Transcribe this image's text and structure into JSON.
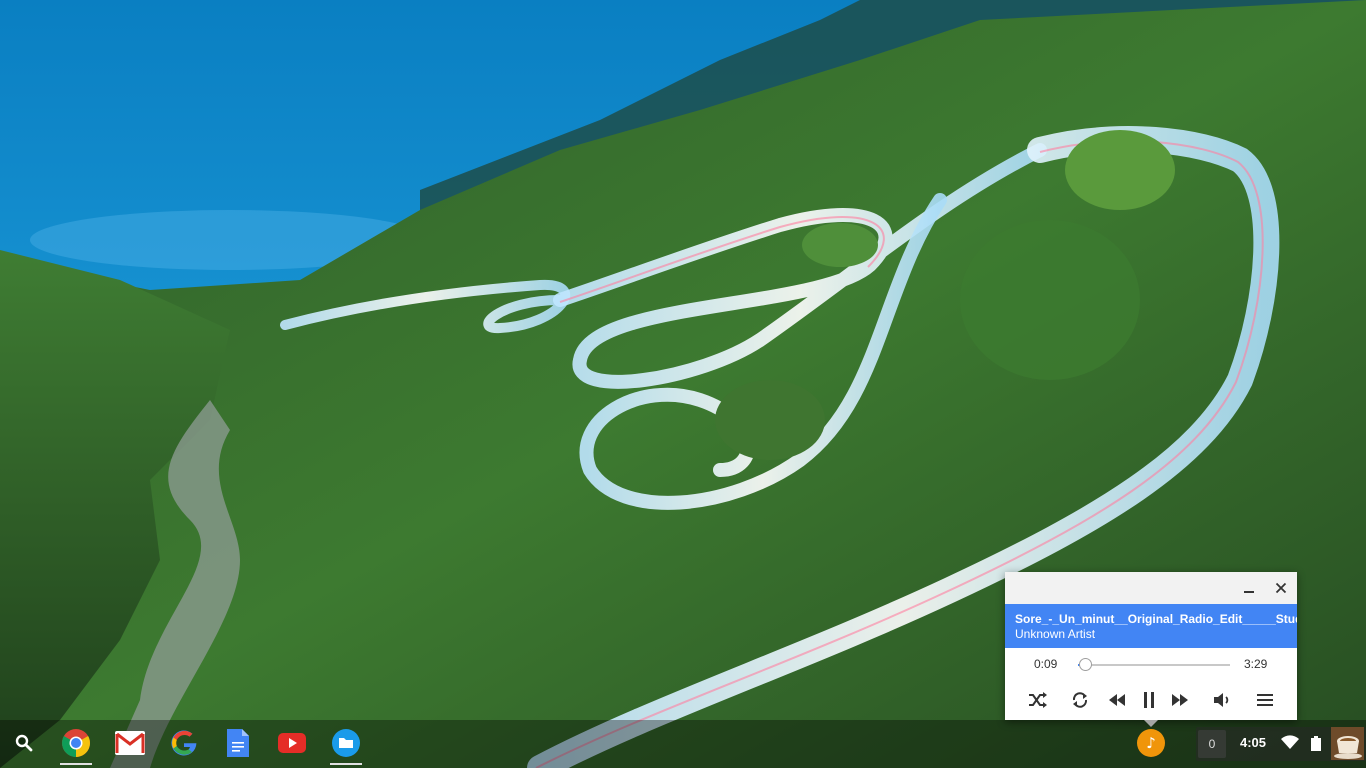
{
  "player": {
    "title": "Sore_-_Un_minut__Original_Radio_Edit_____Studiocrs_",
    "artist": "Unknown Artist",
    "current_time": "0:09",
    "duration": "3:29",
    "progress": 0.043,
    "minimize_icon": "minimize-icon",
    "close_icon": "close-icon",
    "accent_color": "#4285f4"
  },
  "shelf": {
    "apps": [
      {
        "name": "launcher",
        "icon": "search-icon"
      },
      {
        "name": "Chrome",
        "icon": "chrome-icon",
        "running": true
      },
      {
        "name": "Gmail",
        "icon": "gmail-icon"
      },
      {
        "name": "Google",
        "icon": "google-icon"
      },
      {
        "name": "Docs",
        "icon": "docs-icon"
      },
      {
        "name": "YouTube",
        "icon": "youtube-icon"
      },
      {
        "name": "Files",
        "icon": "files-icon",
        "running": true
      }
    ],
    "music_notification_icon": "music-note-icon",
    "music_notification_color": "#f0950a"
  },
  "status": {
    "notification_count": "0",
    "clock": "4:05",
    "wifi_icon": "wifi-icon",
    "battery_icon": "battery-icon"
  }
}
